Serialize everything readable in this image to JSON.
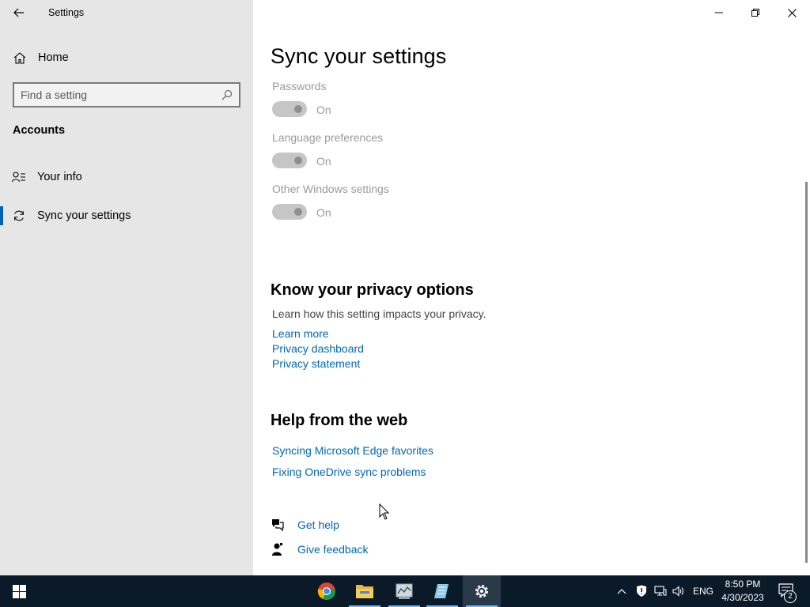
{
  "window": {
    "title": "Settings",
    "back_icon": "back-arrow-icon",
    "minimize_icon": "minimize-icon",
    "restore_icon": "restore-icon",
    "close_icon": "close-icon"
  },
  "sidebar": {
    "home_label": "Home",
    "search_placeholder": "Find a setting",
    "section_title": "Accounts",
    "items": [
      {
        "label": "Your info",
        "icon": "person-card-icon",
        "selected": false
      },
      {
        "label": "Sync your settings",
        "icon": "sync-icon",
        "selected": true
      }
    ]
  },
  "main": {
    "title": "Sync your settings",
    "settings": [
      {
        "label": "Passwords",
        "state": "On"
      },
      {
        "label": "Language preferences",
        "state": "On"
      },
      {
        "label": "Other Windows settings",
        "state": "On"
      }
    ],
    "privacy": {
      "heading": "Know your privacy options",
      "description": "Learn how this setting impacts your privacy.",
      "links": [
        "Learn more",
        "Privacy dashboard",
        "Privacy statement"
      ]
    },
    "help": {
      "heading": "Help from the web",
      "links": [
        "Syncing Microsoft Edge favorites",
        "Fixing OneDrive sync problems"
      ]
    },
    "get_help": "Get help",
    "give_feedback": "Give feedback"
  },
  "taskbar": {
    "apps": [
      "chrome-icon",
      "file-explorer-icon",
      "app-icon",
      "notepad-icon",
      "settings-gear-icon"
    ],
    "language": "ENG",
    "time": "8:50 PM",
    "date": "4/30/2023",
    "notification_count": "2"
  },
  "colors": {
    "sidebar_bg": "#e6e6e6",
    "link": "#0067b8",
    "accent": "#0063b1",
    "taskbar_bg": "#0b1a28"
  }
}
